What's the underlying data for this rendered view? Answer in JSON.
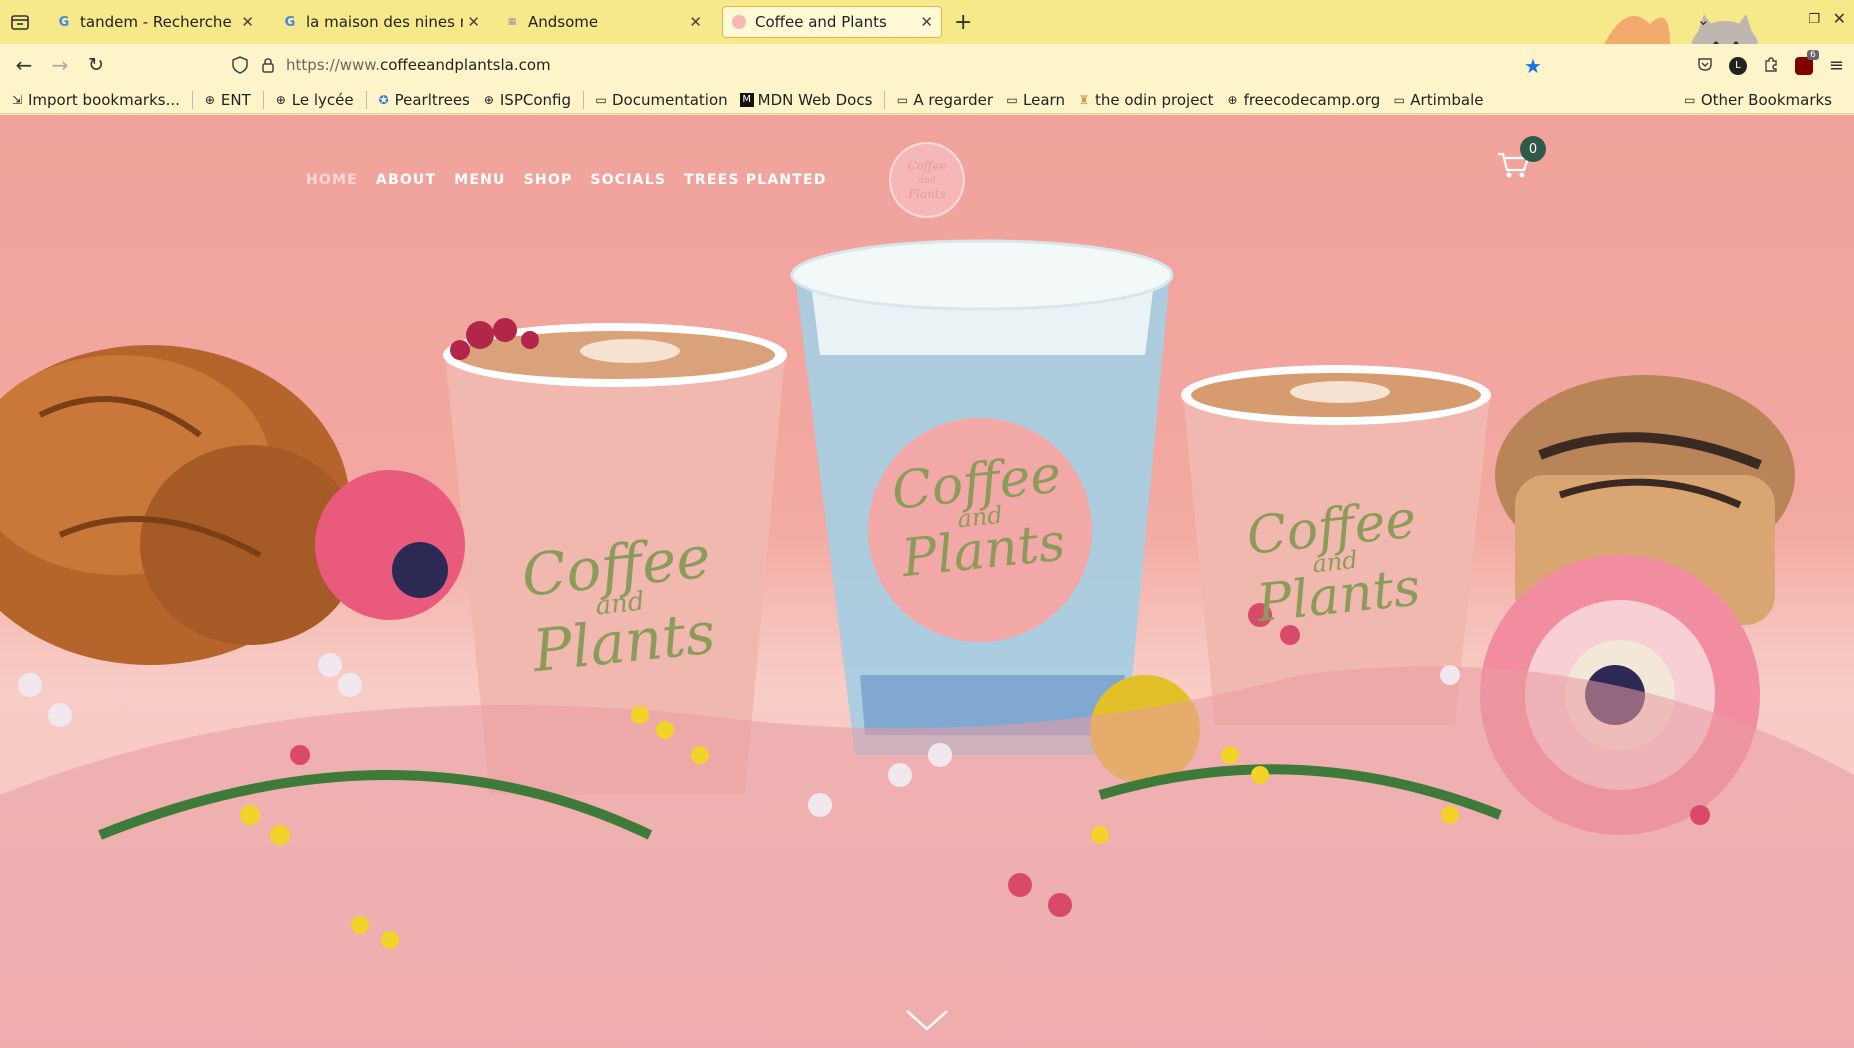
{
  "browser": {
    "tabs": [
      {
        "title": "tandem - Recherche Goog",
        "favicon": "G"
      },
      {
        "title": "la maison des nines marse",
        "favicon": "G"
      },
      {
        "title": "Andsome",
        "favicon": "A"
      },
      {
        "title": "Coffee and Plants",
        "favicon": ""
      }
    ],
    "url_prefix": "https://www.",
    "url_host": "coffeeandplantsla.com",
    "bookmarks": [
      {
        "label": "Import bookmarks...",
        "icon": "import-icon"
      },
      {
        "label": "ENT",
        "icon": "globe-icon"
      },
      {
        "label": "Le lycée",
        "icon": "globe-icon"
      },
      {
        "label": "Pearltrees",
        "icon": "pearltrees-icon"
      },
      {
        "label": "ISPConfig",
        "icon": "globe-icon"
      },
      {
        "label": "Documentation",
        "icon": "folder-icon"
      },
      {
        "label": "MDN Web Docs",
        "icon": "mdn-icon"
      },
      {
        "label": "A regarder",
        "icon": "folder-icon"
      },
      {
        "label": "Learn",
        "icon": "folder-icon"
      },
      {
        "label": "the odin project",
        "icon": "odin-icon"
      },
      {
        "label": "freecodecamp.org",
        "icon": "globe-icon"
      },
      {
        "label": "Artimbale",
        "icon": "folder-icon"
      }
    ],
    "other_bookmarks": "Other Bookmarks",
    "extension_badge": "6"
  },
  "site": {
    "nav": [
      "HOME",
      "ABOUT",
      "MENU",
      "SHOP",
      "SOCIALS",
      "TREES PLANTED"
    ],
    "logo_text": [
      "Coffee",
      "and",
      "Plants"
    ],
    "cart_count": "0",
    "cup_brand": [
      "Coffee",
      "and",
      "Plants"
    ]
  },
  "colors": {
    "tabbar": "#f6e98a",
    "accent_bookmark_star": "#1a73e8",
    "site_background": "#f2a7a0",
    "cart_badge": "#2f5a4a",
    "brand_green": "#8d9b5a"
  }
}
